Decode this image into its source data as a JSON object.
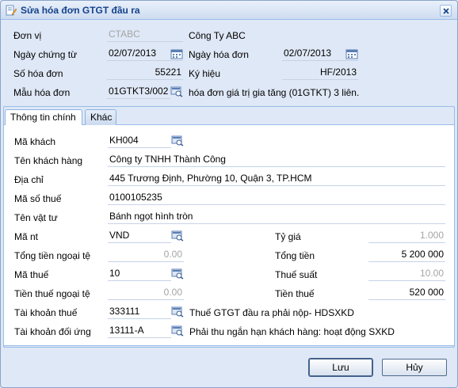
{
  "window": {
    "title": "Sửa hóa đơn GTGT đầu ra"
  },
  "header": {
    "don_vi_label": "Đơn vị",
    "don_vi_code": "CTABC",
    "don_vi_name": "Công Ty ABC",
    "ngay_chung_tu_label": "Ngày chứng từ",
    "ngay_chung_tu_value": "02/07/2013",
    "ngay_hoa_don_label": "Ngày hóa đơn",
    "ngay_hoa_don_value": "02/07/2013",
    "so_hoa_don_label": "Số hóa đơn",
    "so_hoa_don_value": "55221",
    "ky_hieu_label": "Ký hiệu",
    "ky_hieu_value": "HF/2013",
    "mau_hoa_don_label": "Mẫu hóa đơn",
    "mau_hoa_don_value": "01GTKT3/002",
    "mau_hoa_don_desc": "hóa đơn giá trị gia tăng (01GTKT) 3 liên."
  },
  "tabs": [
    {
      "label": "Thông tin chính"
    },
    {
      "label": "Khác"
    }
  ],
  "main": {
    "ma_khach_label": "Mã khách",
    "ma_khach_value": "KH004",
    "ten_khach_hang_label": "Tên khách hàng",
    "ten_khach_hang_value": "Công ty TNHH Thành Công",
    "dia_chi_label": "Địa chỉ",
    "dia_chi_value": "445 Trương Định, Phường 10, Quận 3, TP.HCM",
    "ma_so_thue_label": "Mã số thuế",
    "ma_so_thue_value": "0100105235",
    "ten_vat_tu_label": "Tên vật tư",
    "ten_vat_tu_value": "Bánh ngọt hình tròn",
    "ma_nt_label": "Mã nt",
    "ma_nt_value": "VND",
    "ty_gia_label": "Tỷ giá",
    "ty_gia_value": "1.000",
    "tong_tien_nt_label": "Tổng tiền ngoại tệ",
    "tong_tien_nt_value": "0.00",
    "tong_tien_label": "Tổng tiền",
    "tong_tien_value": "5 200 000",
    "ma_thue_label": "Mã thuế",
    "ma_thue_value": "10",
    "thue_suat_label": "Thuế suất",
    "thue_suat_value": "10.00",
    "tien_thue_nt_label": "Tiền thuế ngoại tệ",
    "tien_thue_nt_value": "0.00",
    "tien_thue_label": "Tiền thuế",
    "tien_thue_value": "520 000",
    "tk_thue_label": "Tài khoản thuế",
    "tk_thue_value": "333111",
    "tk_thue_desc": "Thuế GTGT đầu ra phải nộp- HDSXKD",
    "tk_doi_ung_label": "Tài khoản đối ứng",
    "tk_doi_ung_value": "13111-A",
    "tk_doi_ung_desc": "Phải thu ngắn hạn khách hàng: hoạt động SXKD"
  },
  "buttons": {
    "save": "Lưu",
    "cancel": "Hủy"
  },
  "icons": {
    "title": "edit-document-icon",
    "calendar": "calendar-icon",
    "lookup": "lookup-icon",
    "close": "close-icon"
  },
  "colors": {
    "title_text": "#15428b",
    "panel_border": "#99bbe8",
    "background": "#dfe8f6",
    "disabled_text": "#a5a5a5"
  }
}
